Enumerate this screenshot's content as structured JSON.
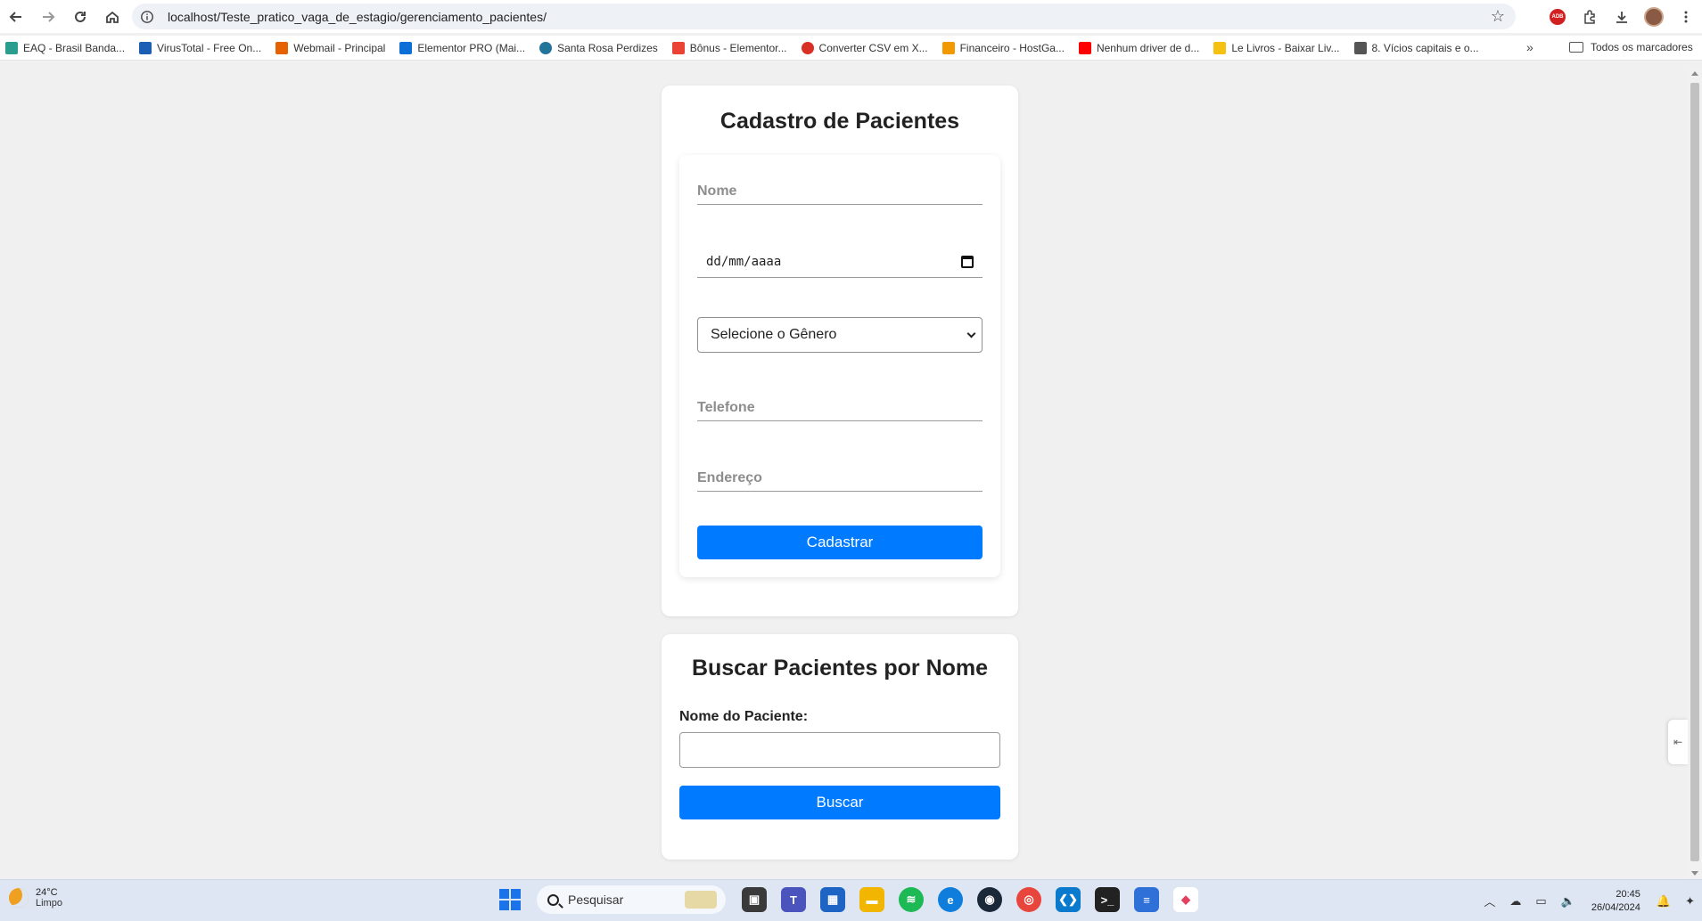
{
  "browser": {
    "url": "localhost/Teste_pratico_vaga_de_estagio/gerenciamento_pacientes/"
  },
  "bookmarks": [
    {
      "label": "EAQ - Brasil Banda...",
      "color": "#2a9d8f"
    },
    {
      "label": "VirusTotal - Free On...",
      "color": "#1a5fb4"
    },
    {
      "label": "Webmail - Principal",
      "color": "#e66100"
    },
    {
      "label": "Elementor PRO (Mai...",
      "color": "#0c6fd8"
    },
    {
      "label": "Santa Rosa Perdizes",
      "color": "#21759b"
    },
    {
      "label": "Bônus - Elementor...",
      "color": "#ea4335"
    },
    {
      "label": "Converter CSV em X...",
      "color": "#d93025"
    },
    {
      "label": "Financeiro - HostGa...",
      "color": "#f29900"
    },
    {
      "label": "Nenhum driver de d...",
      "color": "#ff0000"
    },
    {
      "label": "Le Livros - Baixar Liv...",
      "color": "#f5c211"
    },
    {
      "label": "8. Vícios capitais e o...",
      "color": "#555555"
    }
  ],
  "bookmarks_all": "Todos os marcadores",
  "form": {
    "title": "Cadastro de Pacientes",
    "nome_placeholder": "Nome",
    "date_placeholder": "dd/mm/aaaa",
    "genero_selected": "Selecione o Gênero",
    "telefone_placeholder": "Telefone",
    "endereco_placeholder": "Endereço",
    "submit_label": "Cadastrar"
  },
  "search": {
    "title": "Buscar Pacientes por Nome",
    "label": "Nome do Paciente:",
    "value": "",
    "button_label": "Buscar"
  },
  "taskbar": {
    "temperature": "24°C",
    "weather": "Limpo",
    "search_placeholder": "Pesquisar",
    "time": "20:45",
    "date": "26/04/2024"
  },
  "colors": {
    "accent": "#007bff"
  }
}
